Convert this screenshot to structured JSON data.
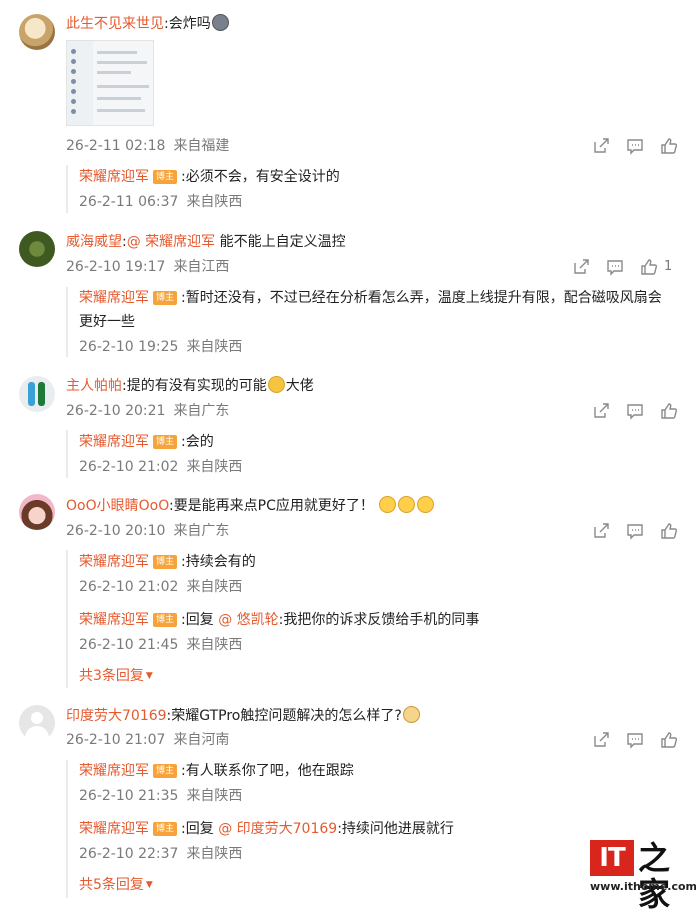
{
  "badge": "博主",
  "comments": [
    {
      "user": "此生不见来世见",
      "sep": ":",
      "text": "会炸吗",
      "emoji": "cat-emoji",
      "date": "26-2-11 02:18",
      "loc": "来自福建",
      "has_image": true,
      "replies": [
        {
          "user": "荣耀席迎军",
          "sep": ":",
          "text": "必须不会，有安全设计的",
          "date": "26-2-11 06:37",
          "loc": "来自陕西"
        }
      ]
    },
    {
      "user": "威海威望",
      "sep": ":",
      "mention": "@ 荣耀席迎军",
      "text": "能不能上自定义温控",
      "date": "26-2-10 19:17",
      "loc": "来自江西",
      "likes": "1",
      "replies": [
        {
          "user": "荣耀席迎军",
          "sep": ":",
          "text": "暂时还没有，不过已经在分析看怎么弄，温度上线提升有限，配合磁吸风扇会",
          "text2": "更好一些",
          "date": "26-2-10 19:25",
          "loc": "来自陕西"
        }
      ]
    },
    {
      "user": "主人帕帕",
      "sep": ":",
      "text": "提的有没有实现的可能",
      "text_after": "大佬",
      "emoji": "face-emoji",
      "date": "26-2-10 20:21",
      "loc": "来自广东",
      "replies": [
        {
          "user": "荣耀席迎军",
          "sep": ":",
          "text": "会的",
          "date": "26-2-10 21:02",
          "loc": "来自陕西"
        }
      ]
    },
    {
      "user": "OoO小眼睛OoO",
      "sep": ":",
      "text": "要是能再来点PC应用就更好了！",
      "date": "26-2-10 20:10",
      "loc": "来自广东",
      "replies": [
        {
          "user": "荣耀席迎军",
          "sep": ":",
          "text": "持续会有的",
          "date": "26-2-10 21:02",
          "loc": "来自陕西"
        },
        {
          "user": "荣耀席迎军",
          "sep": ":",
          "prefix": "回复 ",
          "mention": "@ 悠凯轮",
          "text": ":我把你的诉求反馈给手机的同事",
          "date": "26-2-10 21:45",
          "loc": "来自陕西"
        }
      ],
      "more": "共3条回复"
    },
    {
      "user": "印度劳大70169",
      "sep": ":",
      "text": "荣耀GTPro触控问题解决的怎么样了?",
      "emoji": "dog-emoji",
      "date": "26-2-10 21:07",
      "loc": "来自河南",
      "replies": [
        {
          "user": "荣耀席迎军",
          "sep": ":",
          "text": "有人联系你了吧，他在跟踪",
          "date": "26-2-10 21:35",
          "loc": "来自陕西"
        },
        {
          "user": "荣耀席迎军",
          "sep": ":",
          "prefix": "回复 ",
          "mention": "@ 印度劳大70169",
          "text": ":持续问他进展就行",
          "date": "26-2-10 22:37",
          "loc": "来自陕西"
        }
      ],
      "more": "共5条回复"
    }
  ],
  "watermark": {
    "logo": "IT",
    "cn": "之家",
    "url": "www.ithome.com"
  },
  "colors": {
    "accent": "#e65a2f",
    "badge": "#f7a33a",
    "meta": "#7a7a7a",
    "brand_red": "#d9261c"
  },
  "icons": [
    "share-icon",
    "comment-icon",
    "like-icon"
  ]
}
